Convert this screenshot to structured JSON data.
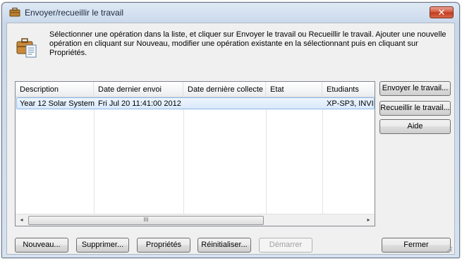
{
  "window": {
    "title": "Envoyer/recueillir le travail",
    "close_glyph": "✕",
    "title_icon": "briefcase-icon"
  },
  "instructions": "Sélectionner une opération dans la liste, et cliquer sur Envoyer le travail ou Recueillir le travail. Ajouter une nouvelle opération en cliquant sur Nouveau, modifier une opération existante en la sélectionnant puis en cliquant sur Propriétés.",
  "list": {
    "columns": [
      "Description",
      "Date dernier envoi",
      "Date dernière collecte",
      "Etat",
      "Etudiants"
    ],
    "rows": [
      {
        "description": "Year 12 Solar System",
        "last_sent": "Fri Jul 20 11:41:00 2012",
        "last_collected": "",
        "state": "",
        "students": "XP-SP3, INVI"
      }
    ],
    "selected_row": 0,
    "scroll": {
      "left_arrow": "◂",
      "right_arrow": "▸",
      "thumb_glyph": "III"
    }
  },
  "side_buttons": {
    "send": "Envoyer le travail...",
    "collect": "Recueillir le travail...",
    "help": "Aide"
  },
  "bottom_buttons": {
    "new": "Nouveau...",
    "delete": "Supprimer...",
    "properties": "Propriétés",
    "reset": "Réinitialiser...",
    "start": "Démarrer",
    "close": "Fermer"
  },
  "colors": {
    "accent": "#3399ff",
    "close_button": "#c2391d",
    "selection": "#d9e9fb"
  }
}
